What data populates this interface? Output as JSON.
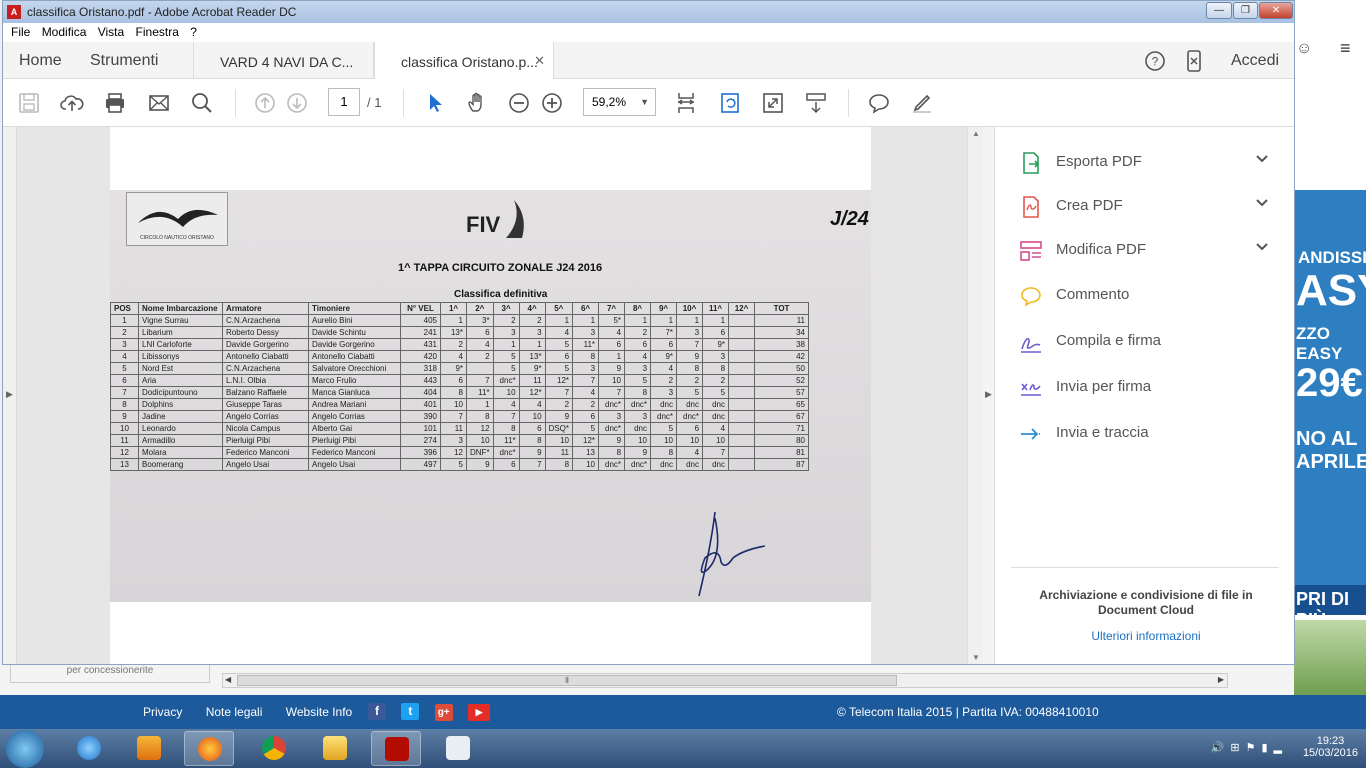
{
  "window": {
    "title": "classifica Oristano.pdf - Adobe Acrobat Reader DC",
    "controls": [
      "—",
      "❐",
      "✕"
    ]
  },
  "menu": [
    "File",
    "Modifica",
    "Vista",
    "Finestra",
    "?"
  ],
  "tabs": {
    "home": "Home",
    "tools": "Strumenti",
    "doc1": "VARD 4 NAVI DA C...",
    "doc2": "classifica Oristano.p...",
    "close": "✕",
    "signin": "Accedi"
  },
  "toolbar": {
    "page_current": "1",
    "page_total": "/ 1",
    "zoom": "59,2%"
  },
  "right_pane": {
    "items": [
      {
        "label": "Esporta PDF",
        "icon": "export-pdf-icon",
        "color": "#2a9d5c",
        "expandable": true
      },
      {
        "label": "Crea PDF",
        "icon": "create-pdf-icon",
        "color": "#e2574c",
        "expandable": true
      },
      {
        "label": "Modifica PDF",
        "icon": "edit-pdf-icon",
        "color": "#d64e8b",
        "expandable": true
      },
      {
        "label": "Commento",
        "icon": "comment-icon",
        "color": "#f2b824",
        "expandable": false
      },
      {
        "label": "Compila e firma",
        "icon": "fill-sign-icon",
        "color": "#6e5bd0",
        "expandable": false
      },
      {
        "label": "Invia per firma",
        "icon": "send-sign-icon",
        "color": "#6e5bd0",
        "expandable": false
      },
      {
        "label": "Invia e traccia",
        "icon": "send-track-icon",
        "color": "#2a8fd6",
        "expandable": false
      }
    ],
    "promo": "Archiviazione e condivisione di file in Document Cloud",
    "more": "Ulteriori informazioni"
  },
  "sheet": {
    "club": "CIRCOLO NAUTICO ORISTANO",
    "federation": "FIV",
    "class_logo": "J/24",
    "title": "1^ TAPPA CIRCUITO ZONALE J24 2016",
    "subtitle": "Classifica definitiva",
    "headers": [
      "POS",
      "Nome Imbarcazione",
      "Armatore",
      "Timoniere",
      "N° VEL",
      "1^",
      "2^",
      "3^",
      "4^",
      "5^",
      "6^",
      "7^",
      "8^",
      "9^",
      "10^",
      "11^",
      "12^",
      "TOT"
    ],
    "rows": [
      [
        "1",
        "Vigne Surrau",
        "C.N.Arzachena",
        "Aurelio Bini",
        "405",
        "1",
        "3*",
        "2",
        "2",
        "1",
        "1",
        "5*",
        "1",
        "1",
        "1",
        "1",
        "",
        "11"
      ],
      [
        "2",
        "Libarium",
        "Roberto Dessy",
        "Davide Schintu",
        "241",
        "13*",
        "6",
        "3",
        "3",
        "4",
        "3",
        "4",
        "2",
        "7*",
        "3",
        "6",
        "",
        "34"
      ],
      [
        "3",
        "LNI Carloforte",
        "Davide Gorgerino",
        "Davide Gorgerino",
        "431",
        "2",
        "4",
        "1",
        "1",
        "5",
        "11*",
        "6",
        "6",
        "6",
        "7",
        "9*",
        "",
        "38"
      ],
      [
        "4",
        "Libissonys",
        "Antonello Ciabatti",
        "Antonello Ciabatti",
        "420",
        "4",
        "2",
        "5",
        "13*",
        "6",
        "8",
        "1",
        "4",
        "9*",
        "9",
        "3",
        "",
        "42"
      ],
      [
        "5",
        "Nord Est",
        "C.N.Arzachena",
        "Salvatore Orecchioni",
        "318",
        "9*",
        "",
        "5",
        "9*",
        "5",
        "3",
        "9",
        "3",
        "4",
        "8",
        "8",
        "",
        "50"
      ],
      [
        "6",
        "Aria",
        "L.N.I. Olbia",
        "Marco Frulio",
        "443",
        "6",
        "7",
        "dnc*",
        "11",
        "12*",
        "7",
        "10",
        "5",
        "2",
        "2",
        "2",
        "",
        "52"
      ],
      [
        "7",
        "Dodicipuntouno",
        "Balzano Raffaele",
        "Manca Gianluca",
        "404",
        "8",
        "11*",
        "10",
        "12*",
        "7",
        "4",
        "7",
        "8",
        "3",
        "5",
        "5",
        "",
        "57"
      ],
      [
        "8",
        "Dolphins",
        "Giuseppe Taras",
        "Andrea Mariani",
        "401",
        "10",
        "1",
        "4",
        "4",
        "2",
        "2",
        "dnc*",
        "dnc*",
        "dnc",
        "dnc",
        "dnc",
        "",
        "65"
      ],
      [
        "9",
        "Jadine",
        "Angelo Corrias",
        "Angelo Corrias",
        "390",
        "7",
        "8",
        "7",
        "10",
        "9",
        "6",
        "3",
        "3",
        "dnc*",
        "dnc*",
        "dnc",
        "",
        "67"
      ],
      [
        "10",
        "Leonardo",
        "Nicola Campus",
        "Alberto Gai",
        "101",
        "11",
        "12",
        "8",
        "6",
        "DSQ*",
        "5",
        "dnc*",
        "dnc",
        "5",
        "6",
        "4",
        "",
        "71"
      ],
      [
        "11",
        "Armadillo",
        "Pierluigi Pibi",
        "Pierluigi Pibi",
        "274",
        "3",
        "10",
        "11*",
        "8",
        "10",
        "12*",
        "9",
        "10",
        "10",
        "10",
        "10",
        "",
        "80"
      ],
      [
        "12",
        "Molara",
        "Federico Manconi",
        "Federico Manconi",
        "396",
        "12",
        "DNF*",
        "dnc*",
        "9",
        "11",
        "13",
        "8",
        "9",
        "8",
        "4",
        "7",
        "",
        "81"
      ],
      [
        "13",
        "Boomerang",
        "Angelo Usai",
        "Angelo Usai",
        "497",
        "5",
        "9",
        "6",
        "7",
        "8",
        "10",
        "dnc*",
        "dnc*",
        "dnc",
        "dnc",
        "dnc",
        "",
        "87"
      ]
    ]
  },
  "background_page": {
    "permission_text": "per concessionerite",
    "footer_links": [
      "Privacy",
      "Note legali",
      "Website Info"
    ],
    "social": [
      {
        "label": "f",
        "color": "#3b5998",
        "icon": "facebook-icon"
      },
      {
        "label": "t",
        "color": "#1da1f2",
        "icon": "twitter-icon"
      },
      {
        "label": "g+",
        "color": "#dd4b39",
        "icon": "googleplus-icon"
      },
      {
        "label": "▶",
        "color": "#e52d27",
        "icon": "youtube-icon"
      }
    ],
    "copyright": "© Telecom Italia 2015 | Partita IVA: 00488410010",
    "ad": {
      "l1": "ANDISSIMO",
      "l2": "ASY",
      "l3": "ZZO EASY",
      "l4": "29€",
      "l5": "NO AL",
      "l6": "APRILE",
      "bottom": "PRI DI PIÙ"
    }
  },
  "taskbar": {
    "time": "19:23",
    "date": "15/03/2016"
  }
}
